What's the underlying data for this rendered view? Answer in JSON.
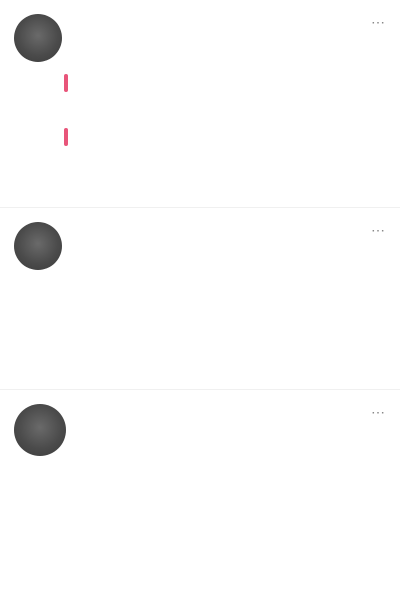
{
  "posts": [
    {
      "author": "",
      "meta": "",
      "list": [
        {
          "title": "",
          "desc": ""
        },
        {
          "title": "",
          "desc": ""
        }
      ],
      "actions": {
        "left": "",
        "middle": "",
        "right": ""
      }
    },
    {
      "author": "",
      "meta": "",
      "rows": [
        {
          "c1": "",
          "c2": ""
        },
        {
          "c1": "",
          "c2": ""
        },
        {
          "c1": "",
          "c2": ""
        }
      ],
      "actions": {
        "left": "",
        "middle": "",
        "right": ""
      }
    },
    {
      "author": "",
      "summary": "",
      "body": "",
      "actions": {
        "left": "",
        "middle": "",
        "right": ""
      }
    }
  ],
  "colors": {
    "accent": "#e8557a",
    "avatar": "#4b4b4b",
    "text": "#1a1a1a",
    "muted": "#777777"
  },
  "icons": {
    "more": "more-options-icon"
  }
}
